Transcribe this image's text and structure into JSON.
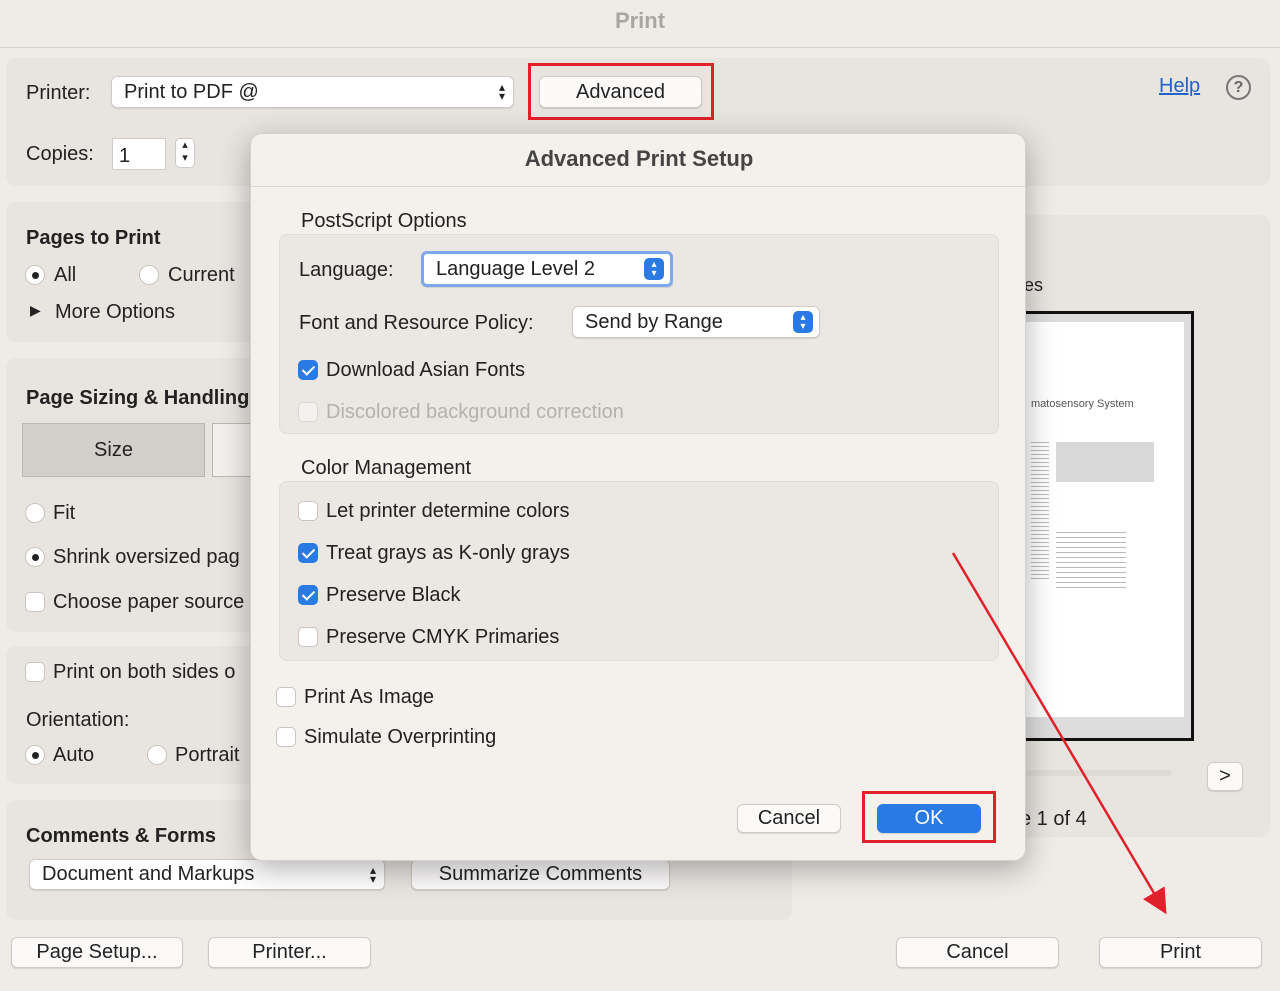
{
  "window": {
    "title": "Print"
  },
  "printer": {
    "label": "Printer:",
    "value": "Print to PDF @",
    "advanced": "Advanced",
    "help": "Help"
  },
  "copies": {
    "label": "Copies:",
    "value": "1"
  },
  "pages": {
    "title": "Pages to Print",
    "all": "All",
    "current": "Current",
    "more": "More Options"
  },
  "sizing": {
    "title": "Page Sizing & Handling",
    "size": "Size",
    "fit": "Fit",
    "shrink": "Shrink oversized pag",
    "paper_source": "Choose paper source"
  },
  "duplex": {
    "both_sides": "Print on both sides o",
    "orientation": "Orientation:",
    "auto": "Auto",
    "portrait": "Portrait"
  },
  "comments": {
    "title": "Comments & Forms",
    "value": "Document and Markups",
    "summarize": "Summarize Comments"
  },
  "preview": {
    "title_fragment": "es",
    "doc_heading": "matosensory System",
    "page_text": "e 1 of 4",
    "next": ">"
  },
  "footer": {
    "page_setup": "Page Setup...",
    "printer": "Printer...",
    "cancel": "Cancel",
    "print": "Print"
  },
  "dialog": {
    "title": "Advanced Print Setup",
    "postscript": {
      "title": "PostScript Options",
      "language_label": "Language:",
      "language_value": "Language Level 2",
      "policy_label": "Font and Resource Policy:",
      "policy_value": "Send by Range",
      "asian_fonts": "Download Asian Fonts",
      "discolored": "Discolored background correction"
    },
    "color": {
      "title": "Color Management",
      "let_printer": "Let printer determine colors",
      "grays": "Treat grays as K-only grays",
      "black": "Preserve Black",
      "cmyk": "Preserve CMYK Primaries"
    },
    "print_as_image": "Print As Image",
    "overprint": "Simulate Overprinting",
    "cancel": "Cancel",
    "ok": "OK"
  },
  "colors": {
    "accent": "#2a7ae4",
    "annotation": "#e0202a"
  }
}
